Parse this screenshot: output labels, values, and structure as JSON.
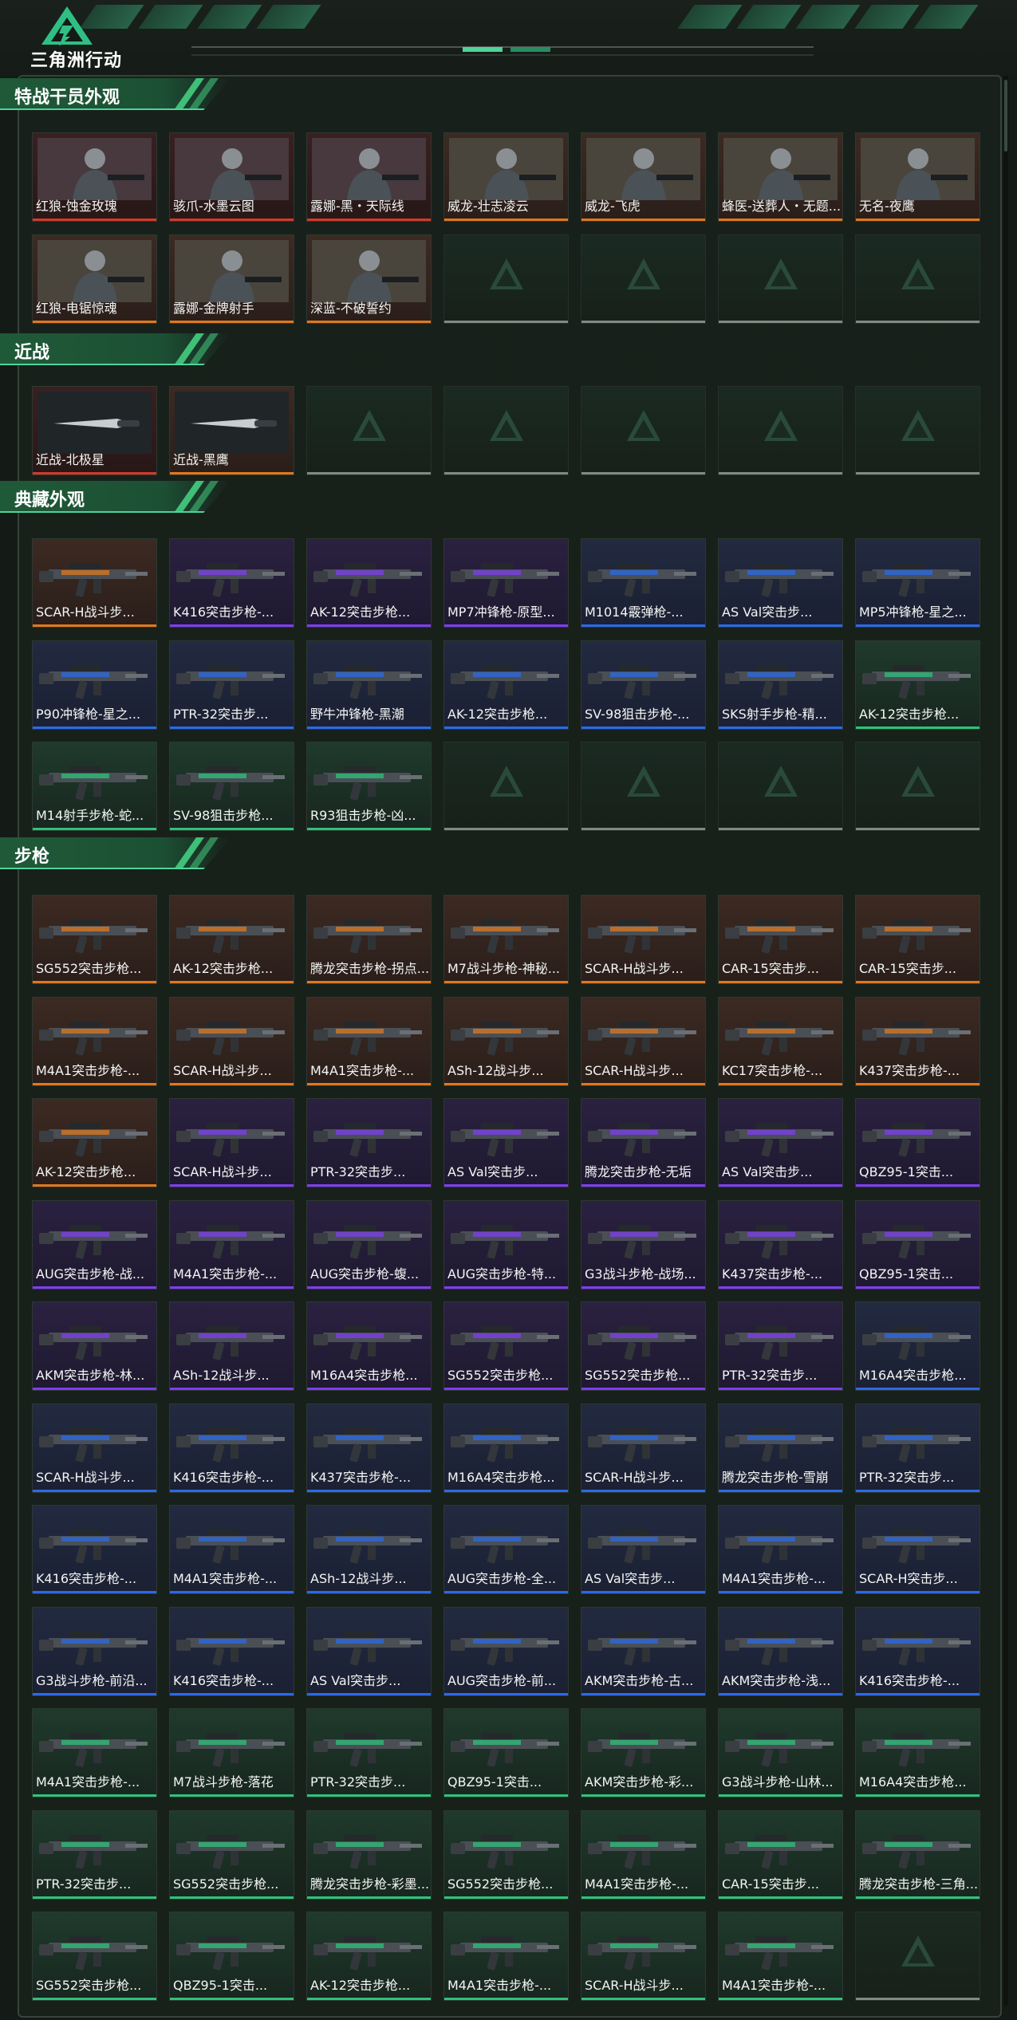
{
  "app": {
    "logo_text": "三角洲行动"
  },
  "colors": {
    "orange": "#e0781e",
    "red": "#d23a2a",
    "purple": "#7f3df0",
    "blue": "#2a6ae8",
    "green": "#2ec27a",
    "gold": "#d9a420"
  },
  "sections": [
    {
      "title": "特战干员外观",
      "items": [
        {
          "label": "红狼-蚀金玫瑰",
          "rarity": "red",
          "icon": "operator-portrait-icon"
        },
        {
          "label": "骇爪-水墨云图",
          "rarity": "red",
          "icon": "operator-portrait-icon"
        },
        {
          "label": "露娜-黑・天际线",
          "rarity": "red",
          "icon": "operator-portrait-icon"
        },
        {
          "label": "威龙-壮志凌云",
          "rarity": "orange",
          "icon": "operator-portrait-icon"
        },
        {
          "label": "威龙-飞虎",
          "rarity": "orange",
          "icon": "operator-portrait-icon"
        },
        {
          "label": "蜂医-送葬人・无题...",
          "rarity": "orange",
          "icon": "operator-portrait-icon"
        },
        {
          "label": "无名-夜鹰",
          "rarity": "orange",
          "icon": "operator-portrait-icon"
        },
        {
          "label": "红狼-电锯惊魂",
          "rarity": "orange",
          "icon": "operator-portrait-icon"
        },
        {
          "label": "露娜-金牌射手",
          "rarity": "orange",
          "icon": "operator-portrait-icon"
        },
        {
          "label": "深蓝-不破誓约",
          "rarity": "orange",
          "icon": "operator-portrait-icon"
        },
        {
          "empty": true
        },
        {
          "empty": true
        },
        {
          "empty": true
        },
        {
          "empty": true
        }
      ]
    },
    {
      "title": "近战",
      "items": [
        {
          "label": "近战-北极星",
          "rarity": "red",
          "icon": "knife-icon"
        },
        {
          "label": "近战-黑鹰",
          "rarity": "orange",
          "icon": "knife-icon"
        },
        {
          "empty": true
        },
        {
          "empty": true
        },
        {
          "empty": true
        },
        {
          "empty": true
        },
        {
          "empty": true
        }
      ]
    },
    {
      "title": "典藏外观",
      "items": [
        {
          "label": "SCAR-H战斗步...",
          "rarity": "orange",
          "icon": "rifle-icon"
        },
        {
          "label": "K416突击步枪-...",
          "rarity": "purple",
          "icon": "rifle-icon"
        },
        {
          "label": "AK-12突击步枪...",
          "rarity": "purple",
          "icon": "rifle-icon"
        },
        {
          "label": "MP7冲锋枪-原型...",
          "rarity": "purple",
          "icon": "smg-icon"
        },
        {
          "label": "M1014霰弹枪-...",
          "rarity": "blue",
          "icon": "shotgun-icon"
        },
        {
          "label": "AS Val突击步...",
          "rarity": "blue",
          "icon": "rifle-icon"
        },
        {
          "label": "MP5冲锋枪-星之...",
          "rarity": "blue",
          "icon": "smg-icon"
        },
        {
          "label": "P90冲锋枪-星之...",
          "rarity": "blue",
          "icon": "smg-icon"
        },
        {
          "label": "PTR-32突击步...",
          "rarity": "blue",
          "icon": "rifle-icon"
        },
        {
          "label": "野牛冲锋枪-黑潮",
          "rarity": "blue",
          "icon": "smg-icon"
        },
        {
          "label": "AK-12突击步枪...",
          "rarity": "blue",
          "icon": "rifle-icon"
        },
        {
          "label": "SV-98狙击步枪-...",
          "rarity": "blue",
          "icon": "sniper-icon"
        },
        {
          "label": "SKS射手步枪-精...",
          "rarity": "blue",
          "icon": "sniper-icon"
        },
        {
          "label": "AK-12突击步枪...",
          "rarity": "green",
          "icon": "rifle-icon"
        },
        {
          "label": "M14射手步枪-蛇...",
          "rarity": "green",
          "icon": "sniper-icon"
        },
        {
          "label": "SV-98狙击步枪...",
          "rarity": "green",
          "icon": "sniper-icon"
        },
        {
          "label": "R93狙击步枪-凶...",
          "rarity": "green",
          "icon": "sniper-icon"
        },
        {
          "empty": true
        },
        {
          "empty": true
        },
        {
          "empty": true
        },
        {
          "empty": true
        }
      ]
    },
    {
      "title": "步枪",
      "items": [
        {
          "label": "SG552突击步枪...",
          "rarity": "orange",
          "icon": "rifle-icon"
        },
        {
          "label": "AK-12突击步枪...",
          "rarity": "orange",
          "icon": "rifle-icon"
        },
        {
          "label": "腾龙突击步枪-拐点...",
          "rarity": "orange",
          "icon": "rifle-icon"
        },
        {
          "label": "M7战斗步枪-神秘...",
          "rarity": "orange",
          "icon": "rifle-icon"
        },
        {
          "label": "SCAR-H战斗步...",
          "rarity": "orange",
          "icon": "rifle-icon"
        },
        {
          "label": "CAR-15突击步...",
          "rarity": "orange",
          "icon": "rifle-icon"
        },
        {
          "label": "CAR-15突击步...",
          "rarity": "orange",
          "icon": "rifle-icon"
        },
        {
          "label": "M4A1突击步枪-...",
          "rarity": "orange",
          "icon": "rifle-icon"
        },
        {
          "label": "SCAR-H战斗步...",
          "rarity": "orange",
          "icon": "rifle-icon"
        },
        {
          "label": "M4A1突击步枪-...",
          "rarity": "orange",
          "icon": "rifle-icon"
        },
        {
          "label": "ASh-12战斗步...",
          "rarity": "orange",
          "icon": "rifle-icon"
        },
        {
          "label": "SCAR-H战斗步...",
          "rarity": "orange",
          "icon": "rifle-icon"
        },
        {
          "label": "KC17突击步枪-...",
          "rarity": "orange",
          "icon": "rifle-icon"
        },
        {
          "label": "K437突击步枪-...",
          "rarity": "orange",
          "icon": "rifle-icon"
        },
        {
          "label": "AK-12突击步枪...",
          "rarity": "orange",
          "icon": "rifle-icon"
        },
        {
          "label": "SCAR-H战斗步...",
          "rarity": "purple",
          "icon": "rifle-icon"
        },
        {
          "label": "PTR-32突击步...",
          "rarity": "purple",
          "icon": "rifle-icon"
        },
        {
          "label": "AS Val突击步...",
          "rarity": "purple",
          "icon": "rifle-icon"
        },
        {
          "label": "腾龙突击步枪-无垢",
          "rarity": "purple",
          "icon": "rifle-icon"
        },
        {
          "label": "AS Val突击步...",
          "rarity": "purple",
          "icon": "rifle-icon"
        },
        {
          "label": "QBZ95-1突击...",
          "rarity": "purple",
          "icon": "rifle-icon"
        },
        {
          "label": "AUG突击步枪-战...",
          "rarity": "purple",
          "icon": "rifle-icon"
        },
        {
          "label": "M4A1突击步枪-...",
          "rarity": "purple",
          "icon": "rifle-icon"
        },
        {
          "label": "AUG突击步枪-蝮...",
          "rarity": "purple",
          "icon": "rifle-icon"
        },
        {
          "label": "AUG突击步枪-特...",
          "rarity": "purple",
          "icon": "rifle-icon"
        },
        {
          "label": "G3战斗步枪-战场...",
          "rarity": "purple",
          "icon": "rifle-icon"
        },
        {
          "label": "K437突击步枪-...",
          "rarity": "purple",
          "icon": "rifle-icon"
        },
        {
          "label": "QBZ95-1突击...",
          "rarity": "purple",
          "icon": "rifle-icon"
        },
        {
          "label": "AKM突击步枪-林...",
          "rarity": "purple",
          "icon": "rifle-icon"
        },
        {
          "label": "ASh-12战斗步...",
          "rarity": "purple",
          "icon": "rifle-icon"
        },
        {
          "label": "M16A4突击步枪...",
          "rarity": "purple",
          "icon": "rifle-icon"
        },
        {
          "label": "SG552突击步枪...",
          "rarity": "purple",
          "icon": "rifle-icon"
        },
        {
          "label": "SG552突击步枪...",
          "rarity": "purple",
          "icon": "rifle-icon"
        },
        {
          "label": "PTR-32突击步...",
          "rarity": "purple",
          "icon": "rifle-icon"
        },
        {
          "label": "M16A4突击步枪...",
          "rarity": "blue",
          "icon": "rifle-icon"
        },
        {
          "label": "SCAR-H战斗步...",
          "rarity": "blue",
          "icon": "rifle-icon"
        },
        {
          "label": "K416突击步枪-...",
          "rarity": "blue",
          "icon": "rifle-icon"
        },
        {
          "label": "K437突击步枪-...",
          "rarity": "blue",
          "icon": "rifle-icon"
        },
        {
          "label": "M16A4突击步枪...",
          "rarity": "blue",
          "icon": "rifle-icon"
        },
        {
          "label": "SCAR-H战斗步...",
          "rarity": "blue",
          "icon": "rifle-icon"
        },
        {
          "label": "腾龙突击步枪-雪崩",
          "rarity": "blue",
          "icon": "rifle-icon"
        },
        {
          "label": "PTR-32突击步...",
          "rarity": "blue",
          "icon": "rifle-icon"
        },
        {
          "label": "K416突击步枪-...",
          "rarity": "blue",
          "icon": "rifle-icon"
        },
        {
          "label": "M4A1突击步枪-...",
          "rarity": "blue",
          "icon": "rifle-icon"
        },
        {
          "label": "ASh-12战斗步...",
          "rarity": "blue",
          "icon": "rifle-icon"
        },
        {
          "label": "AUG突击步枪-全...",
          "rarity": "blue",
          "icon": "rifle-icon"
        },
        {
          "label": "AS Val突击步...",
          "rarity": "blue",
          "icon": "rifle-icon"
        },
        {
          "label": "M4A1突击步枪-...",
          "rarity": "blue",
          "icon": "rifle-icon"
        },
        {
          "label": "SCAR-H突击步...",
          "rarity": "blue",
          "icon": "rifle-icon"
        },
        {
          "label": "G3战斗步枪-前沿...",
          "rarity": "blue",
          "icon": "rifle-icon"
        },
        {
          "label": "K416突击步枪-...",
          "rarity": "blue",
          "icon": "rifle-icon"
        },
        {
          "label": "AS Val突击步...",
          "rarity": "blue",
          "icon": "rifle-icon"
        },
        {
          "label": "AUG突击步枪-前...",
          "rarity": "blue",
          "icon": "rifle-icon"
        },
        {
          "label": "AKM突击步枪-古...",
          "rarity": "blue",
          "icon": "rifle-icon"
        },
        {
          "label": "AKM突击步枪-浅...",
          "rarity": "blue",
          "icon": "rifle-icon"
        },
        {
          "label": "K416突击步枪-...",
          "rarity": "blue",
          "icon": "rifle-icon"
        },
        {
          "label": "M4A1突击步枪-...",
          "rarity": "green",
          "icon": "rifle-icon"
        },
        {
          "label": "M7战斗步枪-落花",
          "rarity": "green",
          "icon": "rifle-icon"
        },
        {
          "label": "PTR-32突击步...",
          "rarity": "green",
          "icon": "rifle-icon"
        },
        {
          "label": "QBZ95-1突击...",
          "rarity": "green",
          "icon": "rifle-icon"
        },
        {
          "label": "AKM突击步枪-彩...",
          "rarity": "green",
          "icon": "rifle-icon"
        },
        {
          "label": "G3战斗步枪-山林...",
          "rarity": "green",
          "icon": "rifle-icon"
        },
        {
          "label": "M16A4突击步枪...",
          "rarity": "green",
          "icon": "rifle-icon"
        },
        {
          "label": "PTR-32突击步...",
          "rarity": "green",
          "icon": "rifle-icon"
        },
        {
          "label": "SG552突击步枪...",
          "rarity": "green",
          "icon": "rifle-icon"
        },
        {
          "label": "腾龙突击步枪-彩墨...",
          "rarity": "green",
          "icon": "rifle-icon"
        },
        {
          "label": "SG552突击步枪...",
          "rarity": "green",
          "icon": "rifle-icon"
        },
        {
          "label": "M4A1突击步枪-...",
          "rarity": "green",
          "icon": "rifle-icon"
        },
        {
          "label": "CAR-15突击步...",
          "rarity": "green",
          "icon": "rifle-icon"
        },
        {
          "label": "腾龙突击步枪-三角...",
          "rarity": "green",
          "icon": "rifle-icon"
        },
        {
          "label": "SG552突击步枪...",
          "rarity": "green",
          "icon": "rifle-icon"
        },
        {
          "label": "QBZ95-1突击...",
          "rarity": "green",
          "icon": "rifle-icon"
        },
        {
          "label": "AK-12突击步枪...",
          "rarity": "green",
          "icon": "rifle-icon"
        },
        {
          "label": "M4A1突击步枪-...",
          "rarity": "green",
          "icon": "rifle-icon"
        },
        {
          "label": "SCAR-H战斗步...",
          "rarity": "green",
          "icon": "rifle-icon"
        },
        {
          "label": "M4A1突击步枪-...",
          "rarity": "green",
          "icon": "rifle-icon"
        },
        {
          "empty": true
        }
      ]
    }
  ]
}
